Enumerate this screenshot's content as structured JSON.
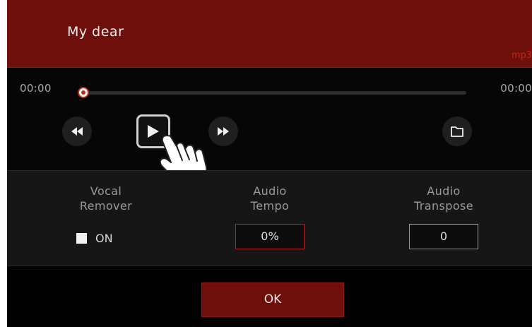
{
  "header": {
    "song_title": "My dear",
    "file_type": "mp3"
  },
  "player": {
    "time_current": "00:00",
    "time_total": "00:00",
    "progress": 0,
    "controls": {
      "rewind_icon": "rewind-icon",
      "play_icon": "play-icon",
      "forward_icon": "fast-forward-icon",
      "folder_icon": "folder-icon"
    },
    "pointer_icon": "hand-pointer-icon"
  },
  "settings": {
    "vocal_remover": {
      "label_line1": "Vocal",
      "label_line2": "Remover",
      "toggle_label": "ON",
      "checked": true
    },
    "audio_tempo": {
      "label_line1": "Audio",
      "label_line2": "Tempo",
      "value": "0%"
    },
    "audio_transpose": {
      "label_line1": "Audio",
      "label_line2": "Transpose",
      "value": "0"
    }
  },
  "footer": {
    "ok_label": "OK"
  },
  "colors": {
    "accent": "#6e0f0c",
    "accent_bright": "#c0281d",
    "background": "#000000"
  }
}
